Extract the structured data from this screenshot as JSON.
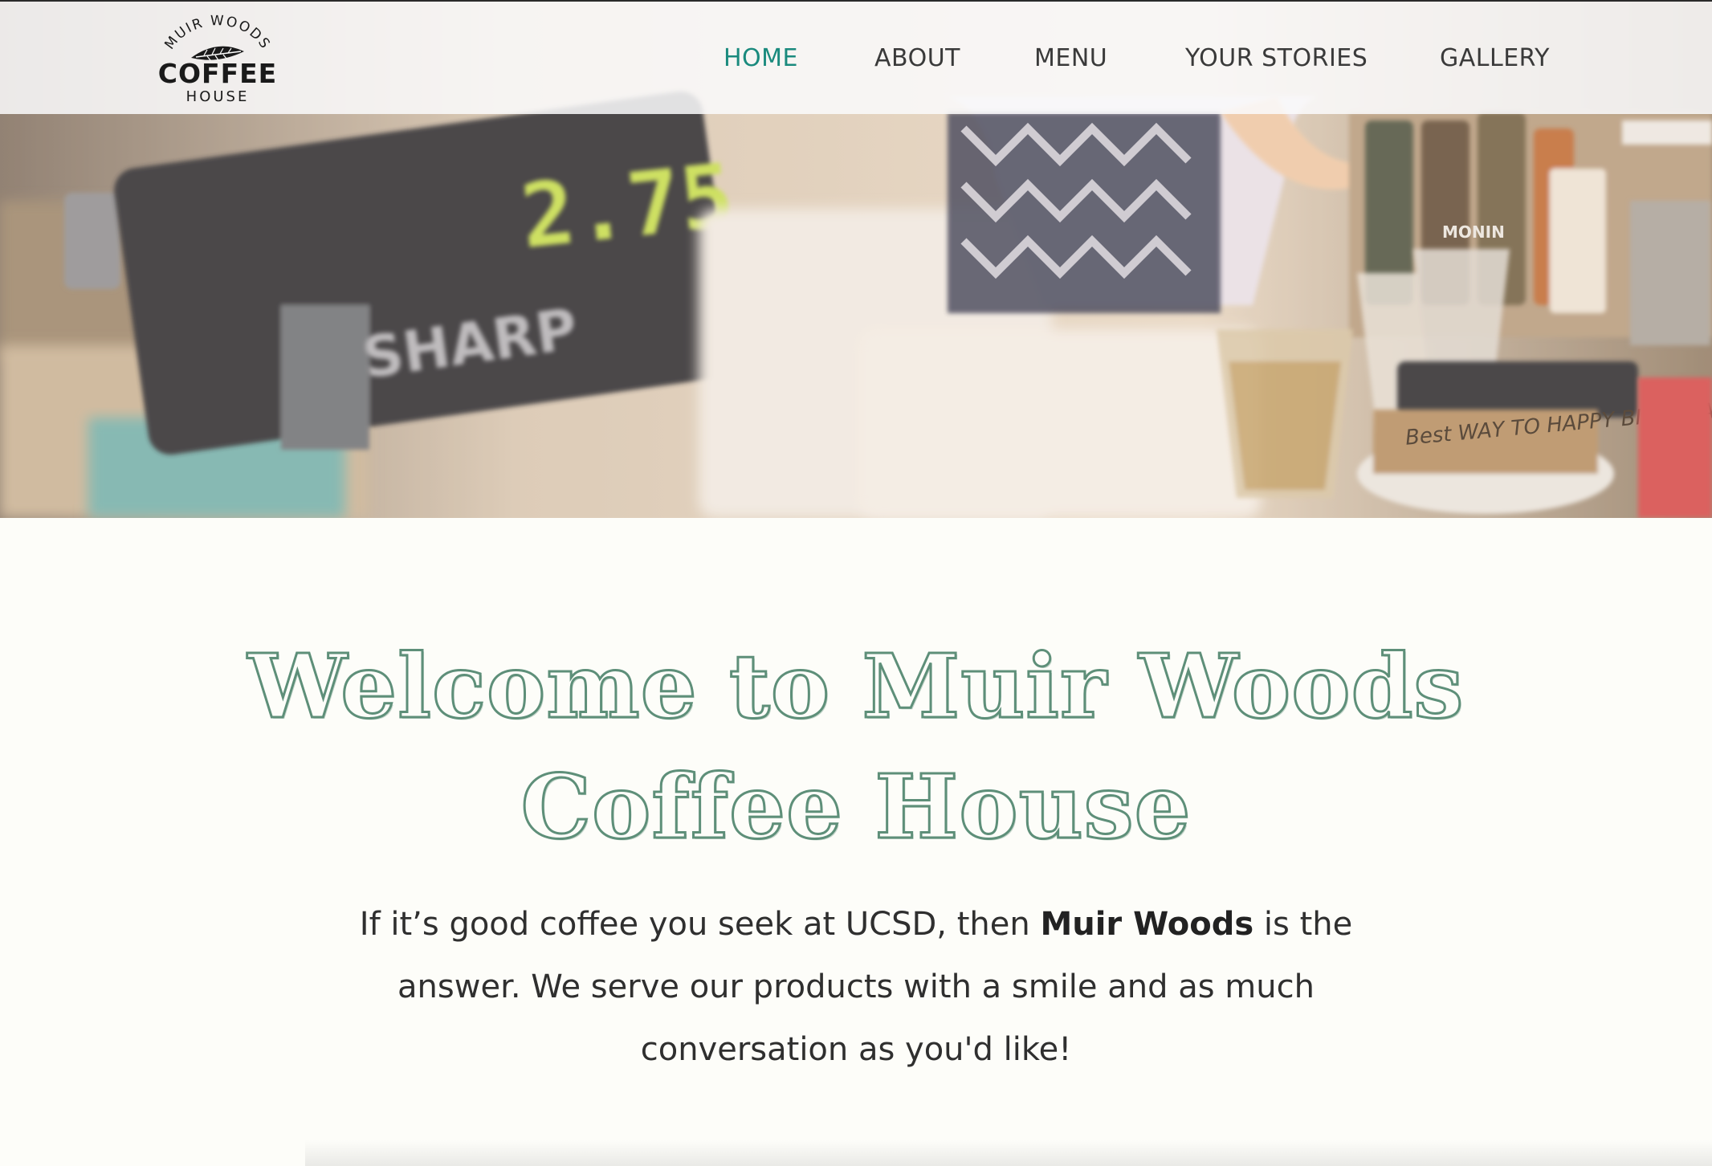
{
  "brand": {
    "logo_top": "MUIR WOODS",
    "logo_main": "COFFEE",
    "logo_bottom": "HOUSE"
  },
  "nav": {
    "items": [
      {
        "label": "HOME",
        "active": true
      },
      {
        "label": "ABOUT",
        "active": false
      },
      {
        "label": "MENU",
        "active": false
      },
      {
        "label": "YOUR STORIES",
        "active": false
      },
      {
        "label": "GALLERY",
        "active": false
      }
    ]
  },
  "hero": {
    "register_display": "2.75",
    "register_brand": "SHARP",
    "tip_jar_note": "Best WAY TO HAPPY BIRTHDAY",
    "bottle_label": "MONIN"
  },
  "content": {
    "heading": "Welcome to Muir Woods Coffee House",
    "intro_before": "If it’s good coffee you seek at UCSD, then ",
    "intro_bold": "Muir Woods",
    "intro_after": " is the answer. We serve our products with a smile and as much conversation as you'd like!"
  },
  "colors": {
    "accent": "#1a8a7d",
    "heading_green": "#5e8f79",
    "nav_text": "#3a3a3a",
    "page_bg": "#fdfdf9"
  }
}
